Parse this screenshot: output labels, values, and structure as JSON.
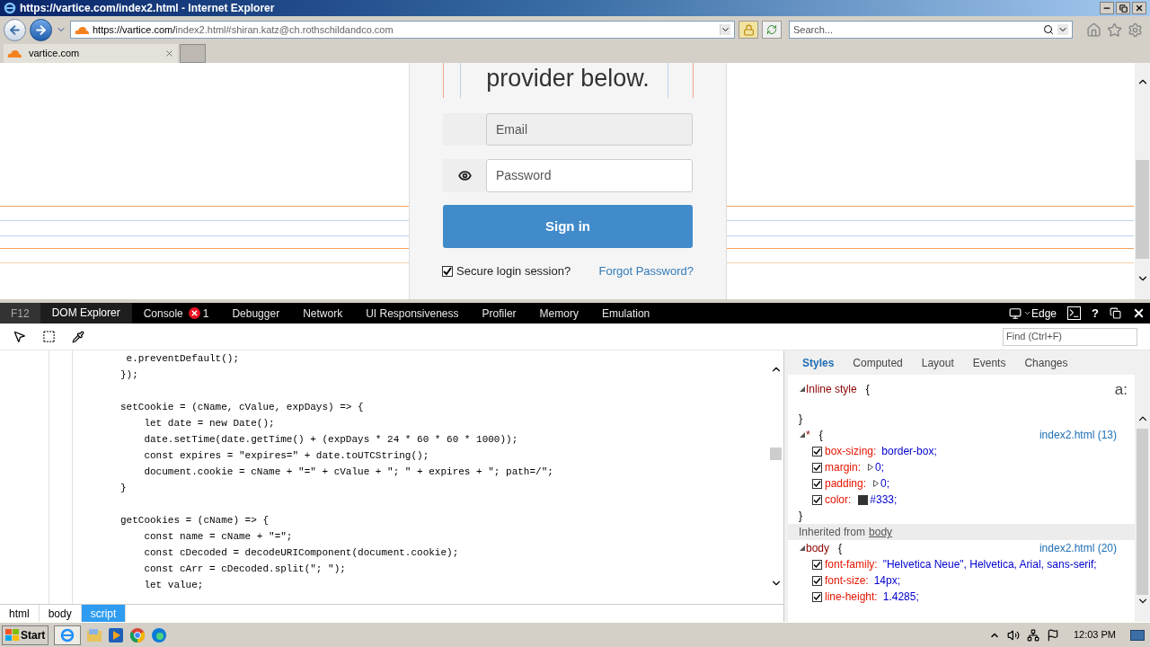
{
  "browser": {
    "title": "https://vartice.com/index2.html - Internet Explorer",
    "url_host": "https://vartice.com/",
    "url_path": "index2.html#shiran.katz@ch.rothschildandco.com",
    "search_placeholder": "Search...",
    "tabs": [
      {
        "label": "vartice.com",
        "selected": true
      }
    ]
  },
  "page": {
    "heading": "provider below.",
    "email_placeholder": "Email",
    "password_placeholder": "Password",
    "sign_in": "Sign in",
    "secure": {
      "label": "Secure login session?",
      "checked": true
    },
    "forgot": "Forgot Password?"
  },
  "devtools": {
    "f12": "F12",
    "tabs": [
      {
        "label": "DOM Explorer",
        "selected": true
      },
      {
        "label": "Console",
        "selected": false,
        "errors": "1"
      },
      {
        "label": "Debugger",
        "selected": false
      },
      {
        "label": "Network",
        "selected": false
      },
      {
        "label": "UI Responsiveness",
        "selected": false
      },
      {
        "label": "Profiler",
        "selected": false
      },
      {
        "label": "Memory",
        "selected": false
      },
      {
        "label": "Emulation",
        "selected": false
      }
    ],
    "mode": "Edge",
    "help": "?",
    "find_placeholder": "Find (Ctrl+F)",
    "code_lines": [
      {
        "kind": "code",
        "text": " e.preventDefault();"
      },
      {
        "kind": "code",
        "text": "});"
      },
      {
        "kind": "blank"
      },
      {
        "kind": "code",
        "text": "setCookie = (cName, cValue, expDays) => {"
      },
      {
        "kind": "code",
        "text": "    let date = new Date();"
      },
      {
        "kind": "code",
        "text": "    date.setTime(date.getTime() + (expDays * 24 * 60 * 60 * 1000));"
      },
      {
        "kind": "code",
        "text": "    const expires = \"expires=\" + date.toUTCString();"
      },
      {
        "kind": "code",
        "text": "    document.cookie = cName + \"=\" + cValue + \"; \" + expires + \"; path=/\";"
      },
      {
        "kind": "code",
        "text": "}"
      },
      {
        "kind": "blank"
      },
      {
        "kind": "code",
        "text": "getCookies = (cName) => {"
      },
      {
        "kind": "code",
        "text": "    const name = cName + \"=\";"
      },
      {
        "kind": "code",
        "text": "    const cDecoded = decodeURIComponent(document.cookie);"
      },
      {
        "kind": "code",
        "text": "    const cArr = cDecoded.split(\"; \");"
      },
      {
        "kind": "code",
        "text": "    let value;"
      }
    ],
    "breadcrumb": [
      {
        "label": "html",
        "selected": false
      },
      {
        "label": "body",
        "selected": false
      },
      {
        "label": "script",
        "selected": true
      }
    ],
    "style_tabs": [
      {
        "label": "Styles",
        "selected": true
      },
      {
        "label": "Computed",
        "selected": false
      },
      {
        "label": "Layout",
        "selected": false
      },
      {
        "label": "Events",
        "selected": false
      },
      {
        "label": "Changes",
        "selected": false
      }
    ],
    "pseudo_toggle": "a:",
    "style_lines": [
      {
        "kind": "selector",
        "selector": "Inline style",
        "brace": "{"
      },
      {
        "kind": "blank"
      },
      {
        "kind": "close",
        "text": "}"
      },
      {
        "kind": "selector",
        "selector": "*",
        "brace": "{",
        "source": "index2.html (13)"
      },
      {
        "kind": "prop",
        "name": "box-sizing:",
        "value": "border-box;",
        "checked": true
      },
      {
        "kind": "prop",
        "name": "margin:",
        "value": "0;",
        "checked": true,
        "expandable": true
      },
      {
        "kind": "prop",
        "name": "padding:",
        "value": "0;",
        "checked": true,
        "expandable": true
      },
      {
        "kind": "prop",
        "name": "color:",
        "value": "#333;",
        "checked": true,
        "swatch": true
      },
      {
        "kind": "close",
        "text": "}"
      },
      {
        "kind": "inherited",
        "prefix": "Inherited from",
        "link": "body"
      },
      {
        "kind": "selector",
        "selector": "body",
        "brace": "{",
        "source": "index2.html (20)"
      },
      {
        "kind": "prop",
        "name": "font-family:",
        "value": "\"Helvetica Neue\", Helvetica, Arial, sans-serif;",
        "checked": true
      },
      {
        "kind": "prop",
        "name": "font-size:",
        "value": "14px;",
        "checked": true
      },
      {
        "kind": "prop",
        "name": "line-height:",
        "value": "1.4285;",
        "checked": true
      }
    ]
  },
  "taskbar": {
    "start": "Start",
    "time": "12:03 PM"
  }
}
